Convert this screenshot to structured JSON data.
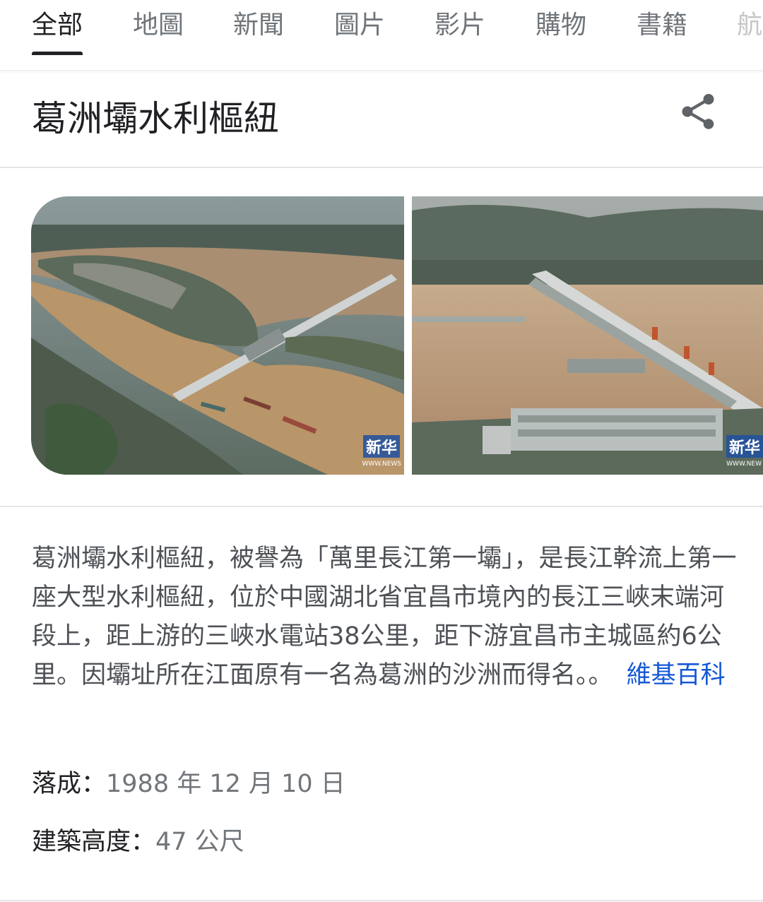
{
  "tabs": [
    {
      "label": "全部",
      "active": true
    },
    {
      "label": "地圖"
    },
    {
      "label": "新聞"
    },
    {
      "label": "圖片"
    },
    {
      "label": "影片"
    },
    {
      "label": "購物"
    },
    {
      "label": "書籍"
    },
    {
      "label": "航"
    }
  ],
  "panel": {
    "title": "葛洲壩水利樞紐",
    "share_icon": "share-icon",
    "images": [
      {
        "watermark": "新华",
        "watermark_sub": "WWW.NEWS"
      },
      {
        "watermark": "新华",
        "watermark_sub": "WWW.NEW"
      }
    ],
    "description": "葛洲壩水利樞紐，被譽為「萬里長江第一壩」，是長江幹流上第一座大型水利樞紐，位於中國湖北省宜昌市境內的長江三峽末端河段上，距上游的三峽水電站38公里，距下游宜昌市主城區約6公里。因壩址所在江面原有一名為葛洲的沙洲而得名。。",
    "source_link": "維基百科",
    "facts": [
      {
        "label": "落成：",
        "value": "1988 年 12 月 10 日"
      },
      {
        "label": "建築高度：",
        "value": "47 公尺"
      }
    ]
  },
  "colors": {
    "link": "#1558d6",
    "muted": "#70757a",
    "text": "#202124",
    "river": "#b9956a"
  }
}
